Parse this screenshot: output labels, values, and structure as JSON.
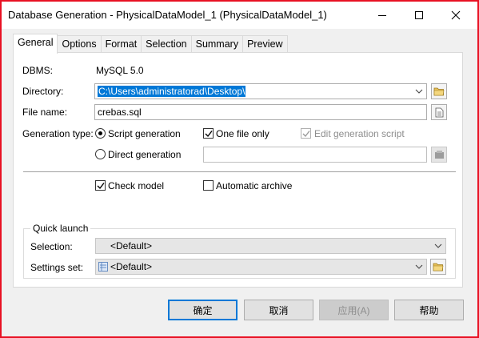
{
  "window": {
    "title": "Database Generation - PhysicalDataModel_1 (PhysicalDataModel_1)"
  },
  "tabs": [
    "General",
    "Options",
    "Format",
    "Selection",
    "Summary",
    "Preview"
  ],
  "active_tab": "General",
  "general": {
    "dbms_label": "DBMS:",
    "dbms_value": "MySQL 5.0",
    "directory_label": "Directory:",
    "directory_value": "C:\\Users\\administratorad\\Desktop\\",
    "filename_label": "File name:",
    "filename_value": "crebas.sql",
    "generation_type_label": "Generation type:",
    "script_generation_label": "Script generation",
    "script_generation_selected": true,
    "direct_generation_label": "Direct generation",
    "direct_generation_selected": false,
    "one_file_only_label": "One file only",
    "one_file_only_checked": true,
    "edit_generation_script_label": "Edit generation script",
    "edit_generation_script_checked": true,
    "edit_generation_script_enabled": false,
    "direct_connection_value": "",
    "check_model_label": "Check model",
    "check_model_checked": true,
    "automatic_archive_label": "Automatic archive",
    "automatic_archive_checked": false
  },
  "quick_launch": {
    "title": "Quick launch",
    "selection_label": "Selection:",
    "selection_value": "<Default>",
    "settings_set_label": "Settings set:",
    "settings_set_value": "<Default>"
  },
  "buttons": {
    "ok": "确定",
    "cancel": "取消",
    "apply": "应用(A)",
    "help": "帮助"
  },
  "colors": {
    "selection_highlight": "#0078d7",
    "focus_border": "#e81123"
  }
}
